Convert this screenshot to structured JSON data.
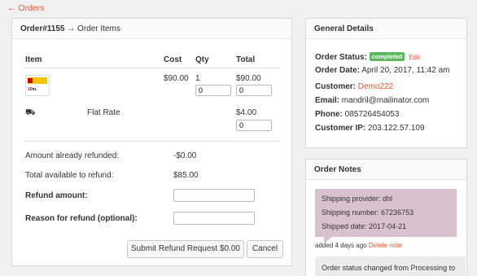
{
  "nav": {
    "back_label": "← Orders"
  },
  "order_panel": {
    "title_order": "Order#1155",
    "title_rest": " → Order Items",
    "columns": {
      "item": "Item",
      "cost": "Cost",
      "qty": "Qty",
      "total": "Total"
    },
    "items": [
      {
        "cost": "$90.00",
        "qty": "1",
        "qty_input": "0",
        "total": "$90.00",
        "total_input": "0"
      }
    ],
    "shipping": {
      "icon": "truck-icon",
      "label": "Flat Rate",
      "total": "$4.00",
      "total_input": "0"
    },
    "refund": {
      "already_label": "Amount already refunded:",
      "already_value": "-$0.00",
      "available_label": "Total available to refund:",
      "available_value": "$85.00",
      "amount_label": "Refund amount:",
      "reason_label": "Reason for refund (optional):",
      "submit_label": "Submit Refund Request $0.00",
      "cancel_label": "Cancel"
    }
  },
  "general": {
    "title": "General Details",
    "status_label": "Order Status:",
    "status_value": "completed",
    "status_color": "#5cb85c",
    "edit_label": "Edit",
    "date_label": "Order Date:",
    "date_value": "April 20, 2017, 11:42 am",
    "customer_label": "Customer:",
    "customer_value": "Demo222",
    "email_label": "Email:",
    "email_value": "mandril@mailinator.com",
    "phone_label": "Phone:",
    "phone_value": "085726454053",
    "ip_label": "Customer IP:",
    "ip_value": "203.122.57.109"
  },
  "notes": {
    "title": "Order Notes",
    "note1": {
      "lines": [
        "Shipping provider: dhl",
        "Shipping number: 67236753",
        "Shipped date: 2017-04-21"
      ],
      "meta": "added 4 days ago",
      "delete_label": "Delete note"
    },
    "note2_text": "Order status changed from Processing to Completed."
  },
  "colors": {
    "accent": "#e8542f",
    "note_bg": "#d9c2cf"
  }
}
